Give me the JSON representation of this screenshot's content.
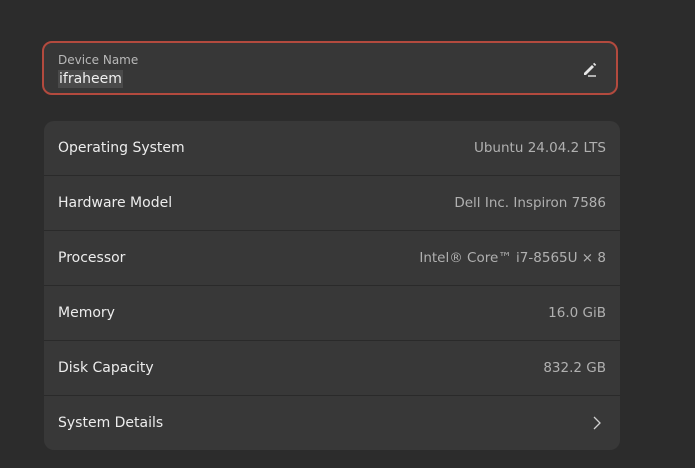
{
  "device_name": {
    "caption": "Device Name",
    "value": "ifraheem",
    "edit_icon": "pencil-edit-icon"
  },
  "info": {
    "rows": [
      {
        "label": "Operating System",
        "value": "Ubuntu 24.04.2 LTS"
      },
      {
        "label": "Hardware Model",
        "value": "Dell Inc. Inspiron 7586"
      },
      {
        "label": "Processor",
        "value": "Intel® Core™ i7-8565U × 8"
      },
      {
        "label": "Memory",
        "value": "16.0 GiB"
      },
      {
        "label": "Disk Capacity",
        "value": "832.2 GB"
      }
    ],
    "details": {
      "label": "System Details",
      "icon": "chevron-right-icon"
    }
  },
  "colors": {
    "background": "#2c2c2c",
    "card": "#383838",
    "focus_border": "#b34a3e"
  }
}
